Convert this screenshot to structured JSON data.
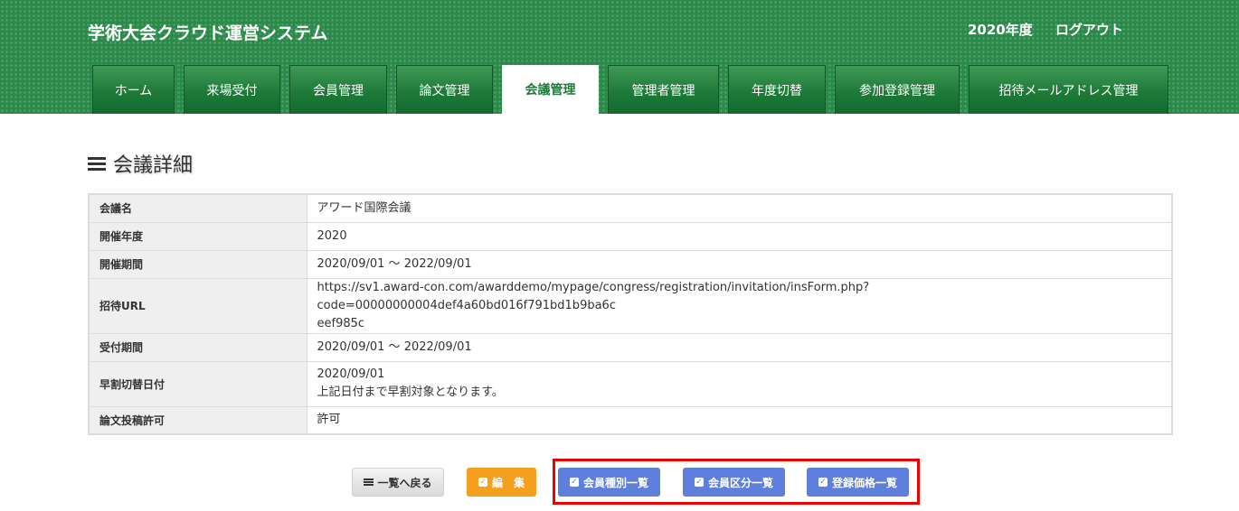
{
  "header": {
    "app_title": "学術大会クラウド運営システム",
    "year": "2020年度",
    "logout": "ログアウト"
  },
  "tabs": [
    {
      "label": "ホーム"
    },
    {
      "label": "来場受付"
    },
    {
      "label": "会員管理"
    },
    {
      "label": "論文管理"
    },
    {
      "label": "会議管理",
      "active": true
    },
    {
      "label": "管理者管理"
    },
    {
      "label": "年度切替"
    },
    {
      "label": "参加登録管理"
    },
    {
      "label": "招待メールアドレス管理"
    }
  ],
  "page": {
    "title": "会議詳細"
  },
  "details": [
    {
      "label": "会議名",
      "value": "アワード国際会議"
    },
    {
      "label": "開催年度",
      "value": "2020"
    },
    {
      "label": "開催期間",
      "value": "2020/09/01 ～ 2022/09/01"
    },
    {
      "label": "招待URL",
      "value_lines": [
        "https://sv1.award-con.com/awarddemo/mypage/congress/registration/invitation/insForm.php?code=00000000004def4a60bd016f791bd1b9ba6c",
        "eef985c"
      ]
    },
    {
      "label": "受付期間",
      "value": "2020/09/01 ～ 2022/09/01"
    },
    {
      "label": "早割切替日付",
      "value_lines": [
        "2020/09/01",
        "上記日付まで早割対象となります。"
      ]
    },
    {
      "label": "論文投稿許可",
      "value": "許可"
    }
  ],
  "buttons": {
    "back": "一覧へ戻る",
    "edit": "編　集",
    "member_types": "会員種別一覧",
    "member_categories": "会員区分一覧",
    "price_list": "登録価格一覧"
  },
  "icons": {
    "menu": "hamburger-icon",
    "list": "list-icon",
    "check": "check-icon"
  },
  "colors": {
    "header_green": "#2b8a4a",
    "edit_orange": "#f59f1e",
    "action_blue": "#5f7fdc",
    "highlight_red": "#ee0000"
  }
}
